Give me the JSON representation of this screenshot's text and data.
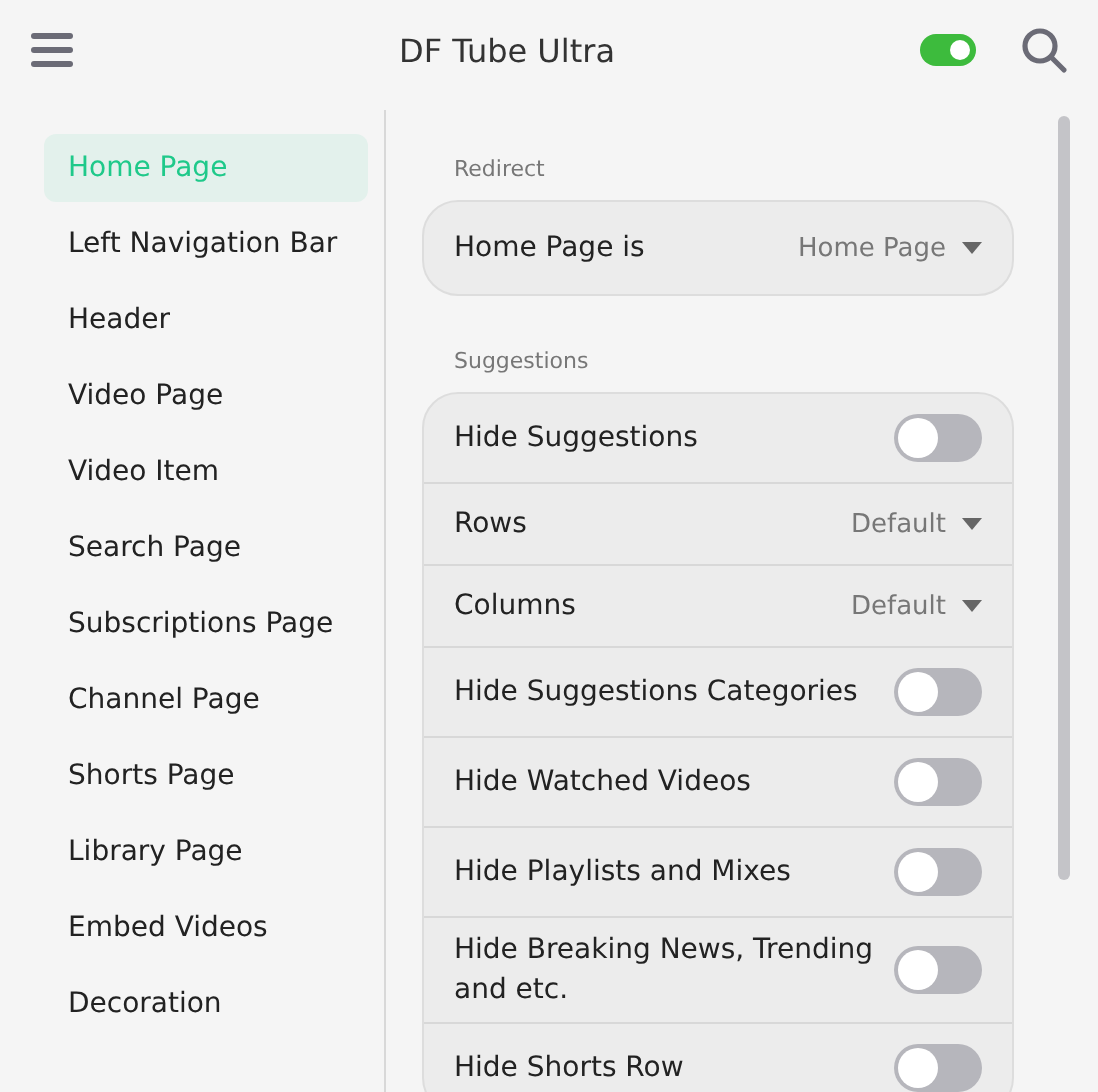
{
  "header": {
    "title": "DF Tube Ultra",
    "enabled": {
      "on": true
    }
  },
  "sidebar": {
    "items": [
      {
        "label": "Home Page",
        "selected": true
      },
      {
        "label": "Left Navigation Bar",
        "selected": false
      },
      {
        "label": "Header",
        "selected": false
      },
      {
        "label": "Video Page",
        "selected": false
      },
      {
        "label": "Video Item",
        "selected": false
      },
      {
        "label": "Search Page",
        "selected": false
      },
      {
        "label": "Subscriptions Page",
        "selected": false
      },
      {
        "label": "Channel Page",
        "selected": false
      },
      {
        "label": "Shorts Page",
        "selected": false
      },
      {
        "label": "Library Page",
        "selected": false
      },
      {
        "label": "Embed Videos",
        "selected": false
      },
      {
        "label": "Decoration",
        "selected": false
      }
    ]
  },
  "sections": [
    {
      "title": "Redirect",
      "rows": [
        {
          "kind": "select",
          "label": "Home Page is",
          "value": "Home Page"
        }
      ]
    },
    {
      "title": "Suggestions",
      "rows": [
        {
          "kind": "toggle",
          "label": "Hide Suggestions",
          "on": false
        },
        {
          "kind": "select",
          "label": "Rows",
          "value": "Default"
        },
        {
          "kind": "select",
          "label": "Columns",
          "value": "Default"
        },
        {
          "kind": "toggle",
          "label": "Hide Suggestions Categories",
          "on": false
        },
        {
          "kind": "toggle",
          "label": "Hide Watched Videos",
          "on": false
        },
        {
          "kind": "toggle",
          "label": "Hide Playlists and Mixes",
          "on": false
        },
        {
          "kind": "toggle",
          "label": "Hide Breaking News, Trending and etc.",
          "on": false
        },
        {
          "kind": "toggle",
          "label": "Hide Shorts Row",
          "on": false
        }
      ]
    }
  ]
}
